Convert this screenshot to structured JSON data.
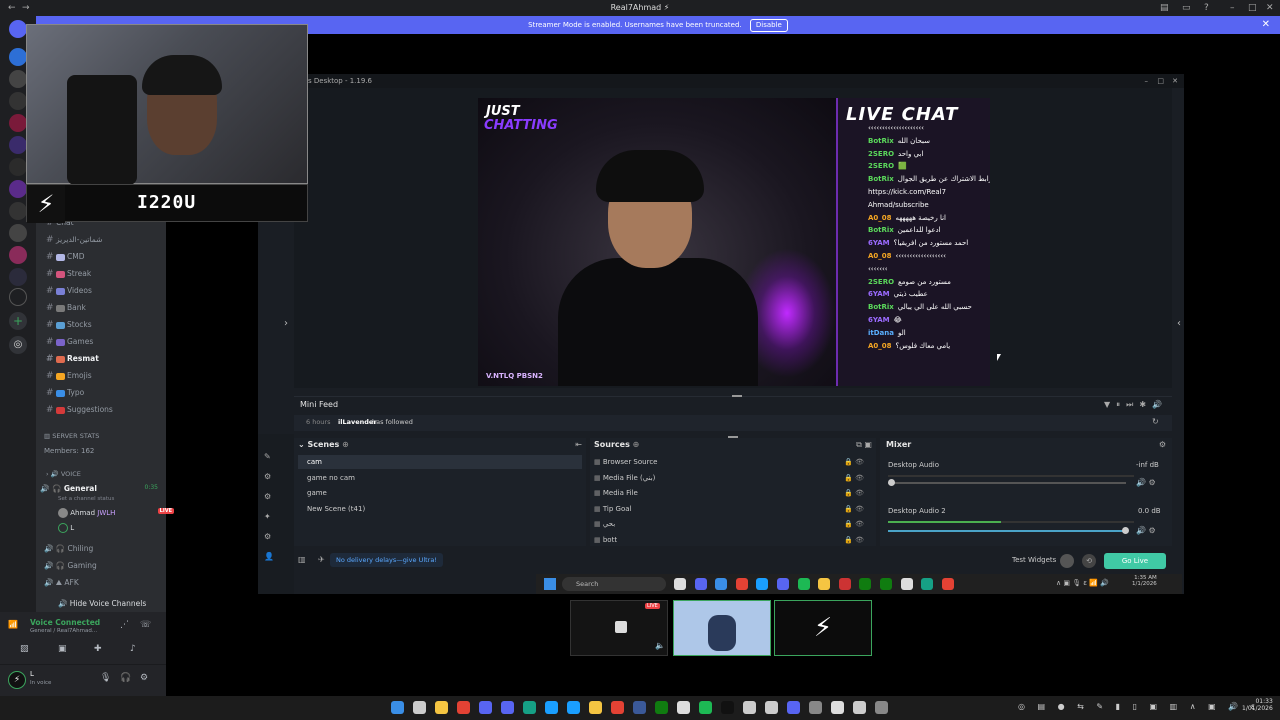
{
  "titlebar": {
    "title": "Real7Ahmad ⚡"
  },
  "banner": {
    "text": "Streamer Mode is enabled. Usernames have been truncated.",
    "button": "Disable"
  },
  "overlay": {
    "name": "I220U",
    "just": "JUST",
    "chatting": "CHATTING",
    "socials": "V.NTLQ  PBSN2"
  },
  "channels": [
    {
      "name": "Chat",
      "icon": "",
      "color": ""
    },
    {
      "name": "شماتين-الديريز",
      "icon": "",
      "color": ""
    },
    {
      "name": "CMD",
      "icon": "🗄",
      "color": "#b3b8e6"
    },
    {
      "name": "Streak",
      "icon": "",
      "color": "#d4547d"
    },
    {
      "name": "Videos",
      "icon": "",
      "color": "#7a80d6"
    },
    {
      "name": "Bank",
      "icon": "",
      "color": "#7a7a7a"
    },
    {
      "name": "Stocks",
      "icon": "",
      "color": "#5a9fd4"
    },
    {
      "name": "Games",
      "icon": "",
      "color": "#7a63c9"
    },
    {
      "name": "Resmat",
      "icon": "",
      "color": "#e06b4f",
      "active": true
    },
    {
      "name": "Emojis",
      "icon": "",
      "color": "#f5a623"
    },
    {
      "name": "Typo",
      "icon": "",
      "color": "#3a8ee6"
    },
    {
      "name": "Suggestions",
      "icon": "",
      "color": "#d43a3a"
    }
  ],
  "server": {
    "stats": "SERVER STATS",
    "members": "Members: 162",
    "voice_cat": "VOICE"
  },
  "voice": {
    "general": "General",
    "general_time": "0:35",
    "set_status": "Set a channel status",
    "member1": "Ahmad",
    "member1_tag": "JWLH",
    "live": "LIVE",
    "member2": "L",
    "chiling": "Chiling",
    "gaming": "Gaming",
    "afk": "AFK",
    "hide": "Hide Voice Channels"
  },
  "voicebar": {
    "status": "Voice Connected",
    "channel": "General / Real7Ahmad..."
  },
  "userbar": {
    "name": "L",
    "status": "In voice"
  },
  "obs": {
    "title": "s Desktop - 1.19.6"
  },
  "chat": {
    "title": "LIVE CHAT",
    "messages": [
      {
        "user": "",
        "color": "#fff",
        "text": "‹‹‹‹‹‹‹‹‹‹‹‹‹‹‹‹‹‹‹‹"
      },
      {
        "user": "BotRix",
        "color": "#5bd95b",
        "text": "سبحان الله"
      },
      {
        "user": "2SERO",
        "color": "#5bd95b",
        "text": "ابي واحد"
      },
      {
        "user": "2SERO",
        "color": "#5bd95b",
        "text": "🟩"
      },
      {
        "user": "BotRix",
        "color": "#5bd95b",
        "text": "رابط الاشتراك عن طريق الجوال"
      },
      {
        "user": "",
        "color": "#fff",
        "text": "https://kick.com/Real7"
      },
      {
        "user": "",
        "color": "#fff",
        "text": "Ahmad/subscribe"
      },
      {
        "user": "A0_08",
        "color": "#f5a623",
        "text": "انا رخيصة هههههه"
      },
      {
        "user": "BotRix",
        "color": "#5bd95b",
        "text": "ادعوا للداعمين"
      },
      {
        "user": "6YAM",
        "color": "#9b6bff",
        "text": "احمد مستورد من افريقيا؟"
      },
      {
        "user": "A0_08",
        "color": "#f5a623",
        "text": "‹‹‹‹‹‹‹‹‹‹‹‹‹‹‹‹‹‹"
      },
      {
        "user": "",
        "color": "#fff",
        "text": "‹‹‹‹‹‹‹"
      },
      {
        "user": "2SERO",
        "color": "#5bd95b",
        "text": "مستورد من صومع"
      },
      {
        "user": "6YAM",
        "color": "#9b6bff",
        "text": "عطيب ذيتي"
      },
      {
        "user": "BotRix",
        "color": "#5bd95b",
        "text": "حسبي الله على الي يبالي"
      },
      {
        "user": "6YAM",
        "color": "#9b6bff",
        "text": "😂"
      },
      {
        "user": "itDana",
        "color": "#5ab0ff",
        "text": "الو"
      },
      {
        "user": "A0_08",
        "color": "#f5a623",
        "text": "يامي معاك فلوس؟"
      }
    ]
  },
  "minifeed": {
    "title": "Mini Feed",
    "time": "6 hours",
    "user": "ilLavender",
    "action": "has followed"
  },
  "scenes": {
    "title": "Scenes",
    "items": [
      "cam",
      "game no cam",
      "game",
      "New Scene (t41)"
    ]
  },
  "sources": {
    "title": "Sources",
    "items": [
      "Browser Source",
      "Media File (بني)",
      "Media File",
      "Tip Goal",
      "بحي",
      "bott"
    ]
  },
  "mixer": {
    "title": "Mixer",
    "ch1": "Desktop Audio",
    "ch1_db": "-inf dB",
    "ch2": "Desktop Audio 2",
    "ch2_db": "0.0 dB"
  },
  "obsfoot": {
    "promo": "No delivery delays—give Ultra!",
    "test": "Test Widgets",
    "golive": "Go Live"
  },
  "winbar": {
    "search": "Search",
    "time": "1:35 AM",
    "date": "1/1/2026"
  },
  "thumbs": {
    "live": "LIVE"
  },
  "taskbar": {
    "time": "01:33",
    "date": "1/01/2026"
  }
}
